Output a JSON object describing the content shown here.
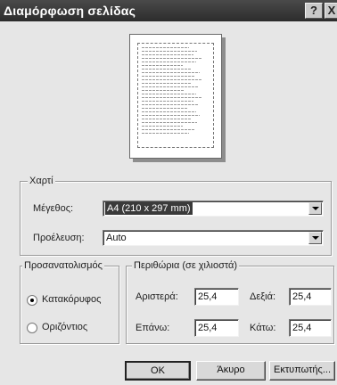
{
  "window": {
    "title": "Διαμόρφωση σελίδας",
    "help_glyph": "?",
    "close_glyph": "X"
  },
  "paper": {
    "legend": "Χαρτί",
    "size_label": "Μέγεθος:",
    "size_value": "A4 (210 x 297 mm)",
    "source_label": "Προέλευση:",
    "source_value": "Auto"
  },
  "orientation": {
    "legend": "Προσανατολισμός",
    "options": [
      {
        "label": "Κατακόρυφος",
        "checked": true
      },
      {
        "label": "Οριζόντιος",
        "checked": false
      }
    ]
  },
  "margins": {
    "legend": "Περιθώρια (σε χιλιοστά)",
    "left_label": "Αριστερά:",
    "left_value": "25,4",
    "right_label": "Δεξιά:",
    "right_value": "25,4",
    "top_label": "Επάνω:",
    "top_value": "25,4",
    "bottom_label": "Κάτω:",
    "bottom_value": "25,4"
  },
  "buttons": {
    "ok": "OK",
    "cancel": "Άκυρο",
    "printer": "Εκτυπωτής..."
  },
  "icons": {
    "help": "question-mark-icon",
    "close": "close-x-icon",
    "dropdown": "chevron-down-icon"
  }
}
